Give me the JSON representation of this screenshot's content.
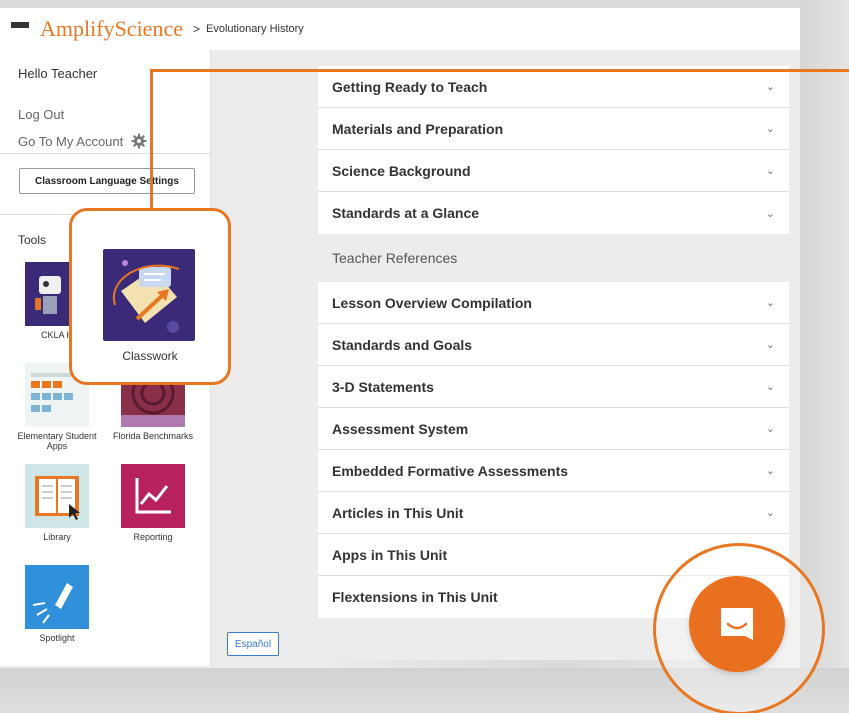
{
  "header": {
    "menu_icon": "hamburger-menu-icon",
    "logo_part1": "Amplify",
    "logo_part2": "Science",
    "breadcrumb_separator": ">",
    "breadcrumb": "Evolutionary History"
  },
  "sidebar": {
    "greeting": "Hello Teacher",
    "logout": "Log Out",
    "account": "Go To My Account",
    "account_icon": "gear-icon",
    "language_button": "Classroom Language Settings",
    "tools_label": "Tools",
    "tools": [
      {
        "label": "CKLA H",
        "icon": "robot-icon"
      },
      {
        "label": "Elementary Student Apps",
        "icon": "app-grid-icon"
      },
      {
        "label": "Florida Benchmarks",
        "icon": "hurricane-map-icon"
      },
      {
        "label": "Library",
        "icon": "book-icon"
      },
      {
        "label": "Reporting",
        "icon": "line-chart-icon"
      },
      {
        "label": "Spotlight",
        "icon": "flashlight-icon"
      }
    ],
    "espanol_button": "Español"
  },
  "callout": {
    "label": "Classwork",
    "icon": "classwork-paper-icon"
  },
  "main": {
    "group1": [
      "Getting Ready to Teach",
      "Materials and Preparation",
      "Science Background",
      "Standards at a Glance"
    ],
    "section_label": "Teacher References",
    "group2": [
      "Lesson Overview Compilation",
      "Standards and Goals",
      "3-D Statements",
      "Assessment System",
      "Embedded Formative Assessments",
      "Articles in This Unit",
      "Apps in This Unit",
      "Flextensions in This Unit"
    ],
    "chevron_icon": "chevron-down-icon"
  },
  "chat": {
    "icon": "chat-bubble-icon"
  },
  "colors": {
    "accent": "#e87722",
    "link_blue": "#3a7bd5"
  }
}
